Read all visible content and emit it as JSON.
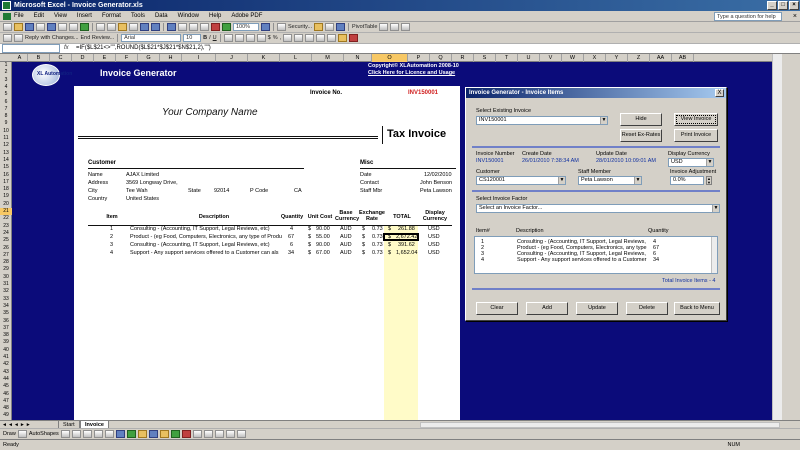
{
  "window": {
    "title": "Microsoft Excel - Invoice Generator.xls"
  },
  "menu": [
    "File",
    "Edit",
    "View",
    "Insert",
    "Format",
    "Tools",
    "Data",
    "Window",
    "Help",
    "Adobe PDF"
  ],
  "help_placeholder": "Type a question for help",
  "toolbar": {
    "security_label": "Security...",
    "pivottable_label": "PivotTable",
    "reply_changes_label": "Reply with Changes...",
    "end_review_label": "End Review...",
    "font": "Arial",
    "font_size": "10",
    "zoom": "100%"
  },
  "formula_bar": {
    "namebox": "",
    "fx": "fx",
    "formula": "=IF($L$21<>\"\",ROUND($L$21*$J$21*$N$21,2),\"\")"
  },
  "columns": [
    "A",
    "B",
    "C",
    "D",
    "E",
    "F",
    "G",
    "H",
    "I",
    "J",
    "K",
    "L",
    "M",
    "N",
    "O",
    "P",
    "Q",
    "R",
    "S",
    "T",
    "U",
    "V",
    "W",
    "X",
    "Y",
    "Z",
    "AA",
    "AB"
  ],
  "rows": [
    "1",
    "2",
    "3",
    "4",
    "5",
    "6",
    "7",
    "8",
    "9",
    "10",
    "11",
    "12",
    "13",
    "14",
    "15",
    "16",
    "17",
    "18",
    "19",
    "20",
    "21",
    "22",
    "23",
    "24",
    "25",
    "26",
    "27",
    "28",
    "29",
    "30",
    "31",
    "32",
    "33",
    "34",
    "35",
    "36",
    "37",
    "38",
    "39",
    "40",
    "41",
    "42",
    "43",
    "44",
    "45",
    "46",
    "47",
    "48",
    "49"
  ],
  "app": {
    "title": "Invoice Generator",
    "logo_text": "XL Automation",
    "copyright": "Copyright© XLAutomation 2008-10",
    "licence_link": "Click Here for Licence and Usage"
  },
  "invoice": {
    "number_label": "Invoice No.",
    "number": "INV150001",
    "company": "Your Company Name",
    "heading": "Tax Invoice",
    "customer_section": "Customer",
    "customer_fields": [
      {
        "label": "Name",
        "value": "AJAX Limited"
      },
      {
        "label": "Address",
        "value": "3569 Longway Drive,"
      },
      {
        "label": "City",
        "value": "Tee Wah"
      },
      {
        "label": "Country",
        "value": "United States"
      }
    ],
    "state_label": "State",
    "state": "92014",
    "pcode_label": "P Code",
    "pcode": "CA",
    "misc_section": "Misc",
    "misc_fields": [
      {
        "label": "Date",
        "value": "12/02/2010"
      },
      {
        "label": "Contact",
        "value": "John Benson"
      },
      {
        "label": "Staff Mbr",
        "value": "Peta Lawson"
      }
    ],
    "columns": {
      "item": "Item",
      "description": "Description",
      "quantity": "Quantity",
      "unit_cost": "Unit Cost",
      "base_currency": "Base Currency",
      "exchange_rate": "Exchange Rate",
      "total": "TOTAL",
      "display_currency": "Display Currency"
    },
    "lines": [
      {
        "item": "1",
        "description": "Consulting - (Accounting, IT Support, Legal Reviews, etc)",
        "quantity": "4",
        "unit_cost": "90.00",
        "base_currency": "AUD",
        "exchange_rate": "0.73",
        "total": "261.88",
        "display_currency": "USD"
      },
      {
        "item": "2",
        "description": "Product - (eg Food, Computers, Electronics, any type of Produ",
        "quantity": "67",
        "unit_cost": "55.00",
        "base_currency": "AUD",
        "exchange_rate": "0.73",
        "total": "2,672.42",
        "display_currency": "USD"
      },
      {
        "item": "3",
        "description": "Consulting - (Accounting, IT Support, Legal Reviews, etc)",
        "quantity": "6",
        "unit_cost": "90.00",
        "base_currency": "AUD",
        "exchange_rate": "0.73",
        "total": "391.62",
        "display_currency": "USD"
      },
      {
        "item": "4",
        "description": "Support - Any support services offered to a Customer can als",
        "quantity": "34",
        "unit_cost": "67.00",
        "base_currency": "AUD",
        "exchange_rate": "0.73",
        "total": "1,652.04",
        "display_currency": "USD"
      }
    ],
    "currency_symbol": "$"
  },
  "dialog": {
    "title": "Invoice Generator - Invoice Items",
    "close": "X",
    "select_existing_label": "Select Existing Invoice",
    "select_existing_value": "INV150001",
    "buttons": {
      "hide": "Hide",
      "view_invoice": "View Invoice",
      "reset_exrates": "Reset Ex-Rates",
      "print_invoice": "Print Invoice",
      "clear": "Clear",
      "add": "Add",
      "update": "Update",
      "delete": "Delete",
      "back_to_menu": "Back to Menu"
    },
    "invoice_number_label": "Invoice Number",
    "invoice_number": "INV150001",
    "create_date_label": "Create Date",
    "create_date": "26/01/2010 7:38:34 AM",
    "update_date_label": "Update Date",
    "update_date": "28/01/2010 10:09:01 AM",
    "display_currency_label": "Display Currency",
    "display_currency": "USD",
    "customer_label": "Customer",
    "customer": "CS120001",
    "staff_label": "Staff Member",
    "staff": "Peta Lawson",
    "adjustment_label": "Invoice Adjustment",
    "adjustment": "0.0%",
    "factor_label": "Select Invoice Factor",
    "factor_placeholder": "Select an Invoice Factor...",
    "list_headers": {
      "item": "Item#",
      "description": "Description",
      "quantity": "Quantity"
    },
    "list_items": [
      {
        "item": "1",
        "description": "Consulting - (Accounting, IT Support, Legal Reviews,",
        "quantity": "4"
      },
      {
        "item": "2",
        "description": "Product - (eg Food, Computers, Electronics, any type",
        "quantity": "67"
      },
      {
        "item": "3",
        "description": "Consulting - (Accounting, IT Support, Legal Reviews,",
        "quantity": "6"
      },
      {
        "item": "4",
        "description": "Support - Any support services offered to a Customer",
        "quantity": "34"
      }
    ],
    "total_items": "Total Invoice Items - 4"
  },
  "sheet_tabs": [
    "Start",
    "Invoice"
  ],
  "drawbar": {
    "draw": "Draw",
    "autoshapes": "AutoShapes"
  },
  "status": {
    "ready": "Ready",
    "num": "NUM"
  }
}
